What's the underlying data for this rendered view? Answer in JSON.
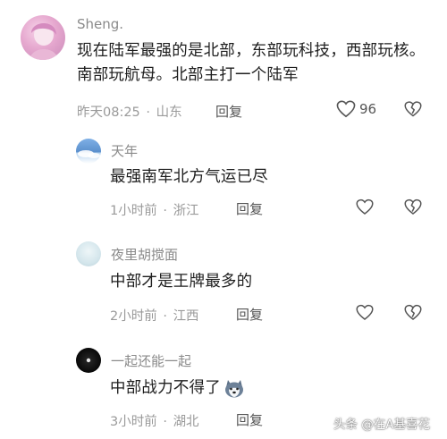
{
  "comments": [
    {
      "author": "Sheng.",
      "text": "现在陆军最强的是北部，东部玩科技，西部玩核。南部玩航母。北部主打一个陆军",
      "time": "昨天08:25",
      "location": "山东",
      "reply_label": "回复",
      "likes": "96"
    },
    {
      "author": "天年",
      "text": "最强南军北方气运已尽",
      "time": "1小时前",
      "location": "浙江",
      "reply_label": "回复",
      "likes": ""
    },
    {
      "author": "夜里胡搅面",
      "text": "中部才是王牌最多的",
      "time": "2小时前",
      "location": "江西",
      "reply_label": "回复",
      "likes": ""
    },
    {
      "author": "一起还能一起",
      "text": "中部战力不得了",
      "time": "3小时前",
      "location": "湖北",
      "reply_label": "回复",
      "likes": ""
    }
  ],
  "meta_separator": "·",
  "watermark": "头条 @在A基喜花",
  "icons": {
    "like": "heart-outline-icon",
    "dislike": "broken-heart-icon",
    "emoji": "husky-dog-emoji-icon"
  }
}
